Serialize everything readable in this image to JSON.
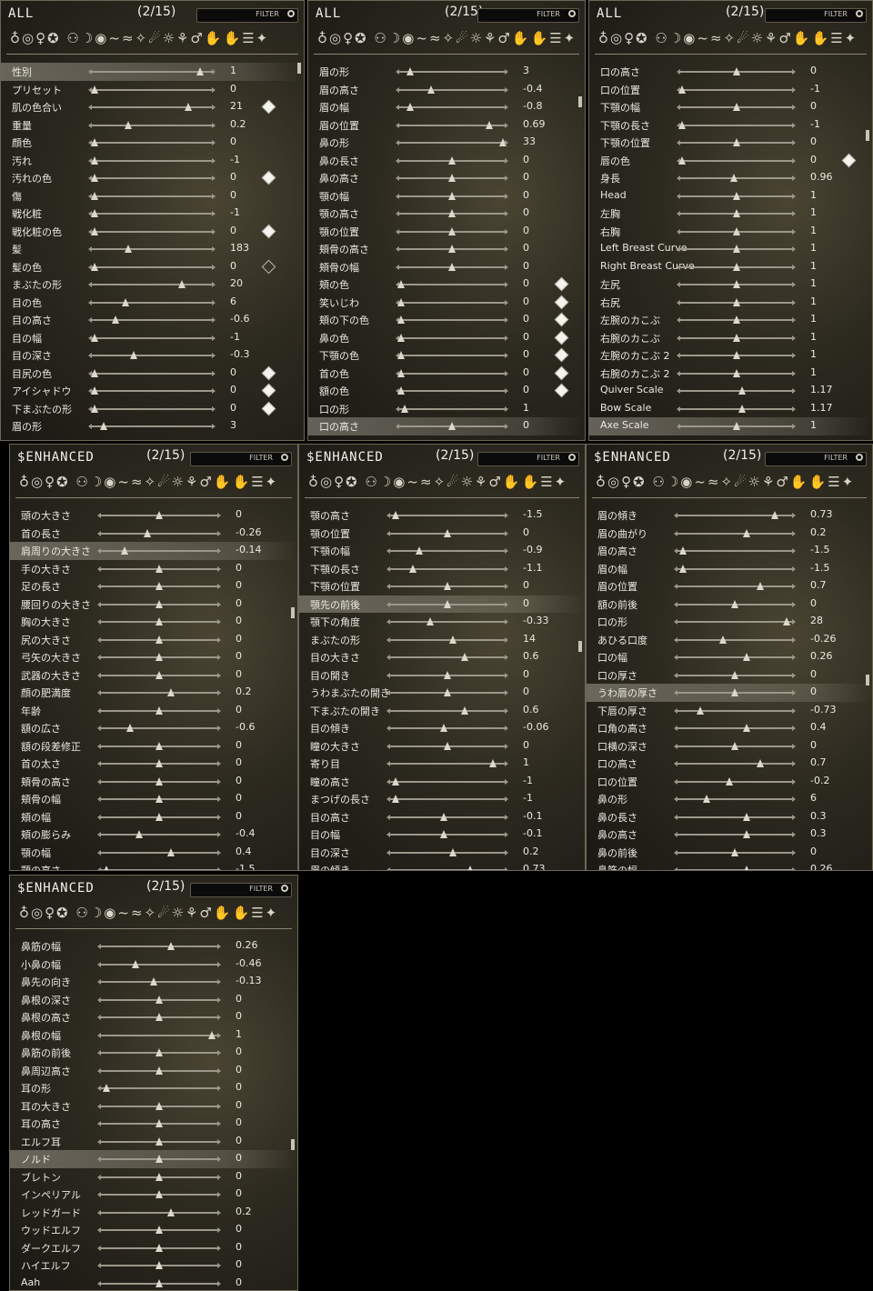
{
  "icon_strip": "♁◎♀✪ ⚇☽◉~≈✧☄☼⚘♂✋✋☰✦",
  "filter_label": "FILTER",
  "panels": [
    {
      "title": "ALL",
      "page": "(2/15)",
      "rows": [
        [
          "性別",
          "1",
          0.9,
          "",
          "sel"
        ],
        [
          "プリセット",
          "0",
          0.02,
          "",
          ""
        ],
        [
          "肌の色合い",
          "21",
          0.8,
          "diamond",
          ""
        ],
        [
          "重量",
          "0.2",
          0.3,
          "",
          ""
        ],
        [
          "顔色",
          "0",
          0.02,
          "",
          ""
        ],
        [
          "汚れ",
          "-1",
          0.02,
          "",
          ""
        ],
        [
          "汚れの色",
          "0",
          0.02,
          "diamond",
          ""
        ],
        [
          "傷",
          "0",
          0.02,
          "",
          ""
        ],
        [
          "戦化粧",
          "-1",
          0.02,
          "",
          ""
        ],
        [
          "戦化粧の色",
          "0",
          0.02,
          "diamond",
          ""
        ],
        [
          "髪",
          "183",
          0.3,
          "",
          ""
        ],
        [
          "髪の色",
          "0",
          0.02,
          "hollow",
          ""
        ],
        [
          "まぶたの形",
          "20",
          0.75,
          "",
          ""
        ],
        [
          "目の色",
          "6",
          0.28,
          "",
          ""
        ],
        [
          "目の高さ",
          "-0.6",
          0.2,
          "",
          ""
        ],
        [
          "目の幅",
          "-1",
          0.02,
          "",
          ""
        ],
        [
          "目の深さ",
          "-0.3",
          0.35,
          "",
          ""
        ],
        [
          "目尻の色",
          "0",
          0.02,
          "diamond",
          ""
        ],
        [
          "アイシャドウ",
          "0",
          0.02,
          "diamond",
          ""
        ],
        [
          "下まぶたの形",
          "0",
          0.02,
          "diamond",
          ""
        ],
        [
          "眉の形",
          "3",
          0.1,
          "",
          ""
        ]
      ]
    },
    {
      "title": "ALL",
      "page": "(2/15)",
      "rows": [
        [
          "眉の形",
          "3",
          0.1,
          "",
          ""
        ],
        [
          "眉の高さ",
          "-0.4",
          0.3,
          "",
          ""
        ],
        [
          "眉の幅",
          "-0.8",
          0.1,
          "",
          ""
        ],
        [
          "眉の位置",
          "0.69",
          0.85,
          "",
          ""
        ],
        [
          "鼻の形",
          "33",
          0.98,
          "",
          ""
        ],
        [
          "鼻の長さ",
          "0",
          0.5,
          "",
          ""
        ],
        [
          "鼻の高さ",
          "0",
          0.5,
          "",
          ""
        ],
        [
          "顎の幅",
          "0",
          0.5,
          "",
          ""
        ],
        [
          "顎の高さ",
          "0",
          0.5,
          "",
          ""
        ],
        [
          "顎の位置",
          "0",
          0.5,
          "",
          ""
        ],
        [
          "頬骨の高さ",
          "0",
          0.5,
          "",
          ""
        ],
        [
          "頬骨の幅",
          "0",
          0.5,
          "",
          ""
        ],
        [
          "頬の色",
          "0",
          0.02,
          "diamond",
          ""
        ],
        [
          "笑いじわ",
          "0",
          0.02,
          "diamond",
          ""
        ],
        [
          "頬の下の色",
          "0",
          0.02,
          "diamond",
          ""
        ],
        [
          "鼻の色",
          "0",
          0.02,
          "diamond",
          ""
        ],
        [
          "下顎の色",
          "0",
          0.02,
          "diamond",
          ""
        ],
        [
          "首の色",
          "0",
          0.02,
          "diamond",
          ""
        ],
        [
          "額の色",
          "0",
          0.02,
          "diamond",
          ""
        ],
        [
          "口の形",
          "1",
          0.05,
          "",
          ""
        ],
        [
          "口の高さ",
          "0",
          0.5,
          "",
          "sel"
        ]
      ]
    },
    {
      "title": "ALL",
      "page": "(2/15)",
      "rows": [
        [
          "口の高さ",
          "0",
          0.5,
          "",
          ""
        ],
        [
          "口の位置",
          "-1",
          0.02,
          "",
          ""
        ],
        [
          "下顎の幅",
          "0",
          0.5,
          "",
          ""
        ],
        [
          "下顎の長さ",
          "-1",
          0.02,
          "",
          ""
        ],
        [
          "下顎の位置",
          "0",
          0.5,
          "",
          ""
        ],
        [
          "唇の色",
          "0",
          0.02,
          "diamond",
          ""
        ],
        [
          "身長",
          "0.96",
          0.48,
          "",
          ""
        ],
        [
          "Head",
          "1",
          0.5,
          "",
          ""
        ],
        [
          "左胸",
          "1",
          0.5,
          "",
          ""
        ],
        [
          "右胸",
          "1",
          0.5,
          "",
          ""
        ],
        [
          "Left Breast Curve",
          "1",
          0.5,
          "",
          ""
        ],
        [
          "Right Breast Curve",
          "1",
          0.5,
          "",
          ""
        ],
        [
          "左尻",
          "1",
          0.5,
          "",
          ""
        ],
        [
          "右尻",
          "1",
          0.5,
          "",
          ""
        ],
        [
          "左腕のカこぶ",
          "1",
          0.5,
          "",
          ""
        ],
        [
          "右腕のカこぶ",
          "1",
          0.5,
          "",
          ""
        ],
        [
          "左腕のカこぶ 2",
          "1",
          0.5,
          "",
          ""
        ],
        [
          "右腕のカこぶ 2",
          "1",
          0.5,
          "",
          ""
        ],
        [
          "Quiver Scale",
          "1.17",
          0.55,
          "",
          ""
        ],
        [
          "Bow Scale",
          "1.17",
          0.55,
          "",
          ""
        ],
        [
          "Axe Scale",
          "1",
          0.5,
          "",
          "sel"
        ]
      ]
    },
    {
      "title": "$ENHANCED",
      "page": "(2/15)",
      "rows": [
        [
          "頭の大きさ",
          "0",
          0.5,
          "",
          ""
        ],
        [
          "首の長さ",
          "-0.26",
          0.4,
          "",
          ""
        ],
        [
          "肩周りの大きさ",
          "-0.14",
          0.2,
          "",
          "sel"
        ],
        [
          "手の大きさ",
          "0",
          0.5,
          "",
          ""
        ],
        [
          "足の長さ",
          "0",
          0.5,
          "",
          ""
        ],
        [
          "腰回りの大きさ",
          "0",
          0.5,
          "",
          ""
        ],
        [
          "胸の大きさ",
          "0",
          0.5,
          "",
          ""
        ],
        [
          "尻の大きさ",
          "0",
          0.5,
          "",
          ""
        ],
        [
          "弓矢の大きさ",
          "0",
          0.5,
          "",
          ""
        ],
        [
          "武器の大きさ",
          "0",
          0.5,
          "",
          ""
        ],
        [
          "顔の肥満度",
          "0.2",
          0.6,
          "",
          ""
        ],
        [
          "年齢",
          "0",
          0.5,
          "",
          ""
        ],
        [
          "額の広さ",
          "-0.6",
          0.25,
          "",
          ""
        ],
        [
          "額の段差修正",
          "0",
          0.5,
          "",
          ""
        ],
        [
          "首の太さ",
          "0",
          0.5,
          "",
          ""
        ],
        [
          "頬骨の高さ",
          "0",
          0.5,
          "",
          ""
        ],
        [
          "頬骨の幅",
          "0",
          0.5,
          "",
          ""
        ],
        [
          "頬の幅",
          "0",
          0.5,
          "",
          ""
        ],
        [
          "頬の膨らみ",
          "-0.4",
          0.33,
          "",
          ""
        ],
        [
          "顎の幅",
          "0.4",
          0.6,
          "",
          ""
        ],
        [
          "顎の高さ",
          "-1.5",
          0.05,
          "",
          ""
        ]
      ]
    },
    {
      "title": "$ENHANCED",
      "page": "(2/15)",
      "rows": [
        [
          "顎の高さ",
          "-1.5",
          0.05,
          "",
          ""
        ],
        [
          "顎の位置",
          "0",
          0.5,
          "",
          ""
        ],
        [
          "下顎の幅",
          "-0.9",
          0.25,
          "",
          ""
        ],
        [
          "下顎の長さ",
          "-1.1",
          0.2,
          "",
          ""
        ],
        [
          "下顎の位置",
          "0",
          0.5,
          "",
          ""
        ],
        [
          "顎先の前後",
          "0",
          0.5,
          "",
          "sel"
        ],
        [
          "顎下の角度",
          "-0.33",
          0.35,
          "",
          ""
        ],
        [
          "まぶたの形",
          "14",
          0.55,
          "",
          ""
        ],
        [
          "目の大きさ",
          "0.6",
          0.65,
          "",
          ""
        ],
        [
          "目の開き",
          "0",
          0.5,
          "",
          ""
        ],
        [
          "うわまぶたの開き",
          "0",
          0.5,
          "",
          ""
        ],
        [
          "下まぶたの開き",
          "0.6",
          0.65,
          "",
          ""
        ],
        [
          "目の傾き",
          "-0.06",
          0.47,
          "",
          ""
        ],
        [
          "瞳の大きさ",
          "0",
          0.5,
          "",
          ""
        ],
        [
          "寄り目",
          "1",
          0.9,
          "",
          ""
        ],
        [
          "瞳の高さ",
          "-1",
          0.05,
          "",
          ""
        ],
        [
          "まつげの長さ",
          "-1",
          0.05,
          "",
          ""
        ],
        [
          "目の高さ",
          "-0.1",
          0.47,
          "",
          ""
        ],
        [
          "目の幅",
          "-0.1",
          0.47,
          "",
          ""
        ],
        [
          "目の深さ",
          "0.2",
          0.55,
          "",
          ""
        ],
        [
          "眉の傾き",
          "0.73",
          0.7,
          "",
          ""
        ]
      ]
    },
    {
      "title": "$ENHANCED",
      "page": "(2/15)",
      "rows": [
        [
          "眉の傾き",
          "0.73",
          0.85,
          "",
          ""
        ],
        [
          "眉の曲がり",
          "0.2",
          0.6,
          "",
          ""
        ],
        [
          "眉の高さ",
          "-1.5",
          0.05,
          "",
          ""
        ],
        [
          "眉の幅",
          "-1.5",
          0.05,
          "",
          ""
        ],
        [
          "眉の位置",
          "0.7",
          0.72,
          "",
          ""
        ],
        [
          "額の前後",
          "0",
          0.5,
          "",
          ""
        ],
        [
          "口の形",
          "28",
          0.95,
          "",
          ""
        ],
        [
          "あひる口度",
          "-0.26",
          0.4,
          "",
          ""
        ],
        [
          "口の幅",
          "0.26",
          0.6,
          "",
          ""
        ],
        [
          "口の厚さ",
          "0",
          0.5,
          "",
          ""
        ],
        [
          "うわ唇の厚さ",
          "0",
          0.5,
          "",
          "sel"
        ],
        [
          "下唇の厚さ",
          "-0.73",
          0.2,
          "",
          ""
        ],
        [
          "口角の高さ",
          "0.4",
          0.6,
          "",
          ""
        ],
        [
          "口横の深さ",
          "0",
          0.5,
          "",
          ""
        ],
        [
          "口の高さ",
          "0.7",
          0.72,
          "",
          ""
        ],
        [
          "口の位置",
          "-0.2",
          0.45,
          "",
          ""
        ],
        [
          "鼻の形",
          "6",
          0.25,
          "",
          ""
        ],
        [
          "鼻の長さ",
          "0.3",
          0.6,
          "",
          ""
        ],
        [
          "鼻の高さ",
          "0.3",
          0.6,
          "",
          ""
        ],
        [
          "鼻の前後",
          "0",
          0.5,
          "",
          ""
        ],
        [
          "鼻筋の幅",
          "0.26",
          0.6,
          "",
          ""
        ]
      ]
    },
    {
      "title": "$ENHANCED",
      "page": "(2/15)",
      "rows": [
        [
          "鼻筋の幅",
          "0.26",
          0.6,
          "",
          ""
        ],
        [
          "小鼻の幅",
          "-0.46",
          0.3,
          "",
          ""
        ],
        [
          "鼻先の向き",
          "-0.13",
          0.45,
          "",
          ""
        ],
        [
          "鼻根の深さ",
          "0",
          0.5,
          "",
          ""
        ],
        [
          "鼻根の高さ",
          "0",
          0.5,
          "",
          ""
        ],
        [
          "鼻根の幅",
          "1",
          0.95,
          "",
          ""
        ],
        [
          "鼻筋の前後",
          "0",
          0.5,
          "",
          ""
        ],
        [
          "鼻周辺高さ",
          "0",
          0.5,
          "",
          ""
        ],
        [
          "耳の形",
          "0",
          0.05,
          "",
          ""
        ],
        [
          "耳の大きさ",
          "0",
          0.5,
          "",
          ""
        ],
        [
          "耳の高さ",
          "0",
          0.5,
          "",
          ""
        ],
        [
          "エルフ耳",
          "0",
          0.5,
          "",
          ""
        ],
        [
          "ノルド",
          "0",
          0.5,
          "",
          "sel"
        ],
        [
          "ブレトン",
          "0",
          0.5,
          "",
          ""
        ],
        [
          "インペリアル",
          "0",
          0.5,
          "",
          ""
        ],
        [
          "レッドガード",
          "0.2",
          0.6,
          "",
          ""
        ],
        [
          "ウッドエルフ",
          "0",
          0.5,
          "",
          ""
        ],
        [
          "ダークエルフ",
          "0",
          0.5,
          "",
          ""
        ],
        [
          "ハイエルフ",
          "0",
          0.5,
          "",
          ""
        ],
        [
          "Aah",
          "0",
          0.5,
          "",
          ""
        ]
      ]
    }
  ]
}
